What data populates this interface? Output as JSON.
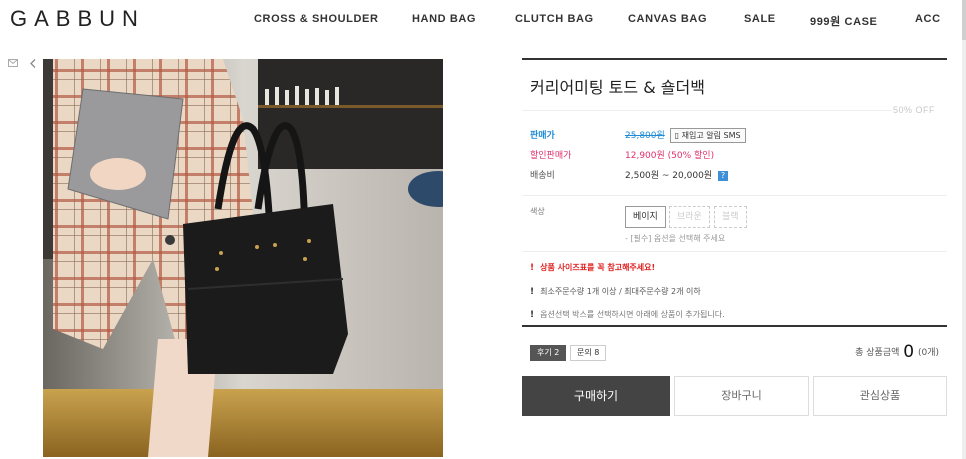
{
  "header": {
    "logo": "GABBUN",
    "nav": [
      "CROSS & SHOULDER",
      "HAND BAG",
      "CLUTCH BAG",
      "CANVAS BAG",
      "SALE",
      "999원 CASE",
      "ACC"
    ]
  },
  "icons": {
    "mail": "envelope-icon",
    "back": "chevron-left-icon"
  },
  "product": {
    "title": "커리어미팅 토드 & 숄더백",
    "discount_badge": "50% OFF",
    "price_label": "판매가",
    "price_original": "25,800원",
    "restock_button": "재입고 알림 SMS",
    "sale_label": "할인판매가",
    "sale_price": "12,900원 (50% 할인)",
    "shipping_label": "배송비",
    "shipping_value": "2,500원 ~ 20,000원",
    "shipping_help": "?",
    "color_label": "색상",
    "color_options": [
      "베이지",
      "브라운",
      "블랙"
    ],
    "color_hint": "- [필수] 옵션을 선택해 주세요",
    "notices": [
      "상품 사이즈표를 꼭 참고해주세요!",
      "최소주문수량 1개 이상 / 최대주문수량 2개 이하",
      "옵션선택 박스를 선택하시면 아래에 상품이 추가됩니다."
    ],
    "tabs": [
      "후기 2",
      "문의 8"
    ],
    "total_label": "총 상품금액",
    "total_amount": "0",
    "total_count": "(0개)",
    "buttons": {
      "buy": "구매하기",
      "cart": "장바구니",
      "wish": "관심상품"
    }
  },
  "colors": {
    "price_label": "#1f8ad6",
    "sale": "#e0306a",
    "alert": "#e02020",
    "buy_bg": "#444444"
  }
}
